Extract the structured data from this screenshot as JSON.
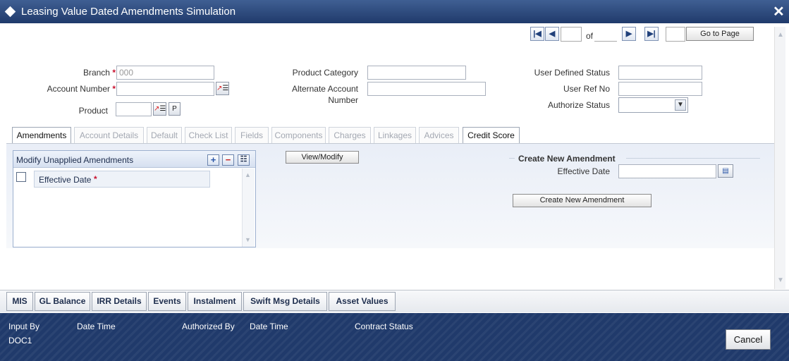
{
  "window": {
    "title": "Leasing Value Dated Amendments Simulation",
    "close_symbol": "✕"
  },
  "pager": {
    "first": "|◀",
    "prev": "◀",
    "of_label": "of",
    "next": "▶",
    "last": "▶|",
    "goto_label": "Go to Page"
  },
  "header_fields": {
    "branch_label": "Branch",
    "branch_value": "000",
    "account_number_label": "Account Number",
    "product_label": "Product",
    "product_category_label": "Product Category",
    "alternate_account_label_1": "Alternate Account",
    "alternate_account_label_2": "Number",
    "user_defined_status_label": "User Defined Status",
    "user_ref_no_label": "User Ref No",
    "authorize_status_label": "Authorize Status",
    "required_mark": "*",
    "lov_button": "↗☰",
    "p_button": "P"
  },
  "tabs": [
    {
      "label": "Amendments",
      "active": true
    },
    {
      "label": "Account Details"
    },
    {
      "label": "Default"
    },
    {
      "label": "Check List"
    },
    {
      "label": "Fields"
    },
    {
      "label": "Components"
    },
    {
      "label": "Charges"
    },
    {
      "label": "Linkages"
    },
    {
      "label": "Advices"
    },
    {
      "label": "Credit Score"
    }
  ],
  "amendments": {
    "grid_title": "Modify Unapplied Amendments",
    "add_symbol": "+",
    "remove_symbol": "−",
    "view_symbol": "☷",
    "column_effective_date": "Effective Date",
    "view_modify_button": "View/Modify",
    "create_section_title": "Create New Amendment",
    "effective_date_label": "Effective Date",
    "calendar_icon": "▤",
    "create_button": "Create New Amendment"
  },
  "bottom_tabs": [
    "MIS",
    "GL Balance",
    "IRR Details",
    "Events",
    "Instalment",
    "Swift Msg Details",
    "Asset Values"
  ],
  "footer": {
    "input_by_label": "Input By",
    "input_by_value": "DOC1",
    "date_time_label": "Date Time",
    "authorized_by_label": "Authorized By",
    "date_time_label_2": "Date Time",
    "contract_status_label": "Contract Status",
    "cancel_button": "Cancel"
  }
}
